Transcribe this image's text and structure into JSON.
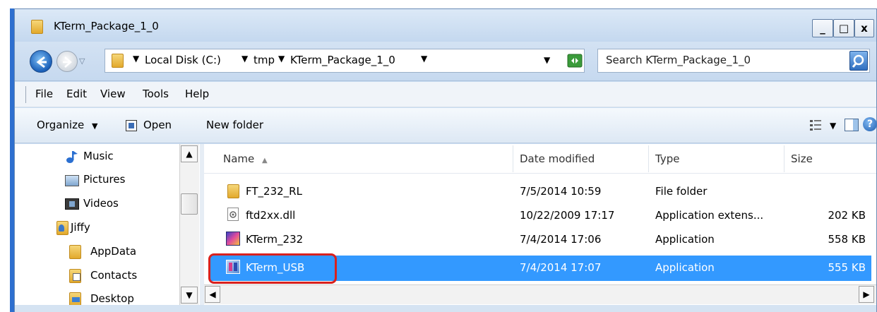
{
  "window": {
    "title": "KTerm_Package_1_0",
    "buttons": {
      "minimize": "_",
      "maximize": "□",
      "close": "x"
    }
  },
  "nav": {
    "breadcrumb": [
      "Local Disk (C:)",
      "tmp",
      "KTerm_Package_1_0"
    ],
    "search_placeholder": "Search KTerm_Package_1_0"
  },
  "menu": [
    "File",
    "Edit",
    "View",
    "Tools",
    "Help"
  ],
  "toolbar": {
    "organize": "Organize",
    "open": "Open",
    "new_folder": "New folder"
  },
  "sidebar": {
    "items": [
      {
        "label": "Music",
        "icon": "music-icon"
      },
      {
        "label": "Pictures",
        "icon": "pictures-icon"
      },
      {
        "label": "Videos",
        "icon": "videos-icon"
      },
      {
        "label": "Jiffy",
        "icon": "user-folder-icon"
      },
      {
        "label": "AppData",
        "icon": "folder-icon"
      },
      {
        "label": "Contacts",
        "icon": "contacts-icon"
      },
      {
        "label": "Desktop",
        "icon": "desktop-icon"
      }
    ]
  },
  "columns": {
    "name": "Name",
    "date": "Date modified",
    "type": "Type",
    "size": "Size"
  },
  "files": [
    {
      "name": "FT_232_RL",
      "date": "7/5/2014 10:59",
      "type": "File folder",
      "size": "",
      "icon": "folder-icon"
    },
    {
      "name": "ftd2xx.dll",
      "date": "10/22/2009 17:17",
      "type": "Application extens...",
      "size": "202 KB",
      "icon": "dll-icon"
    },
    {
      "name": "KTerm_232",
      "date": "7/4/2014 17:06",
      "type": "Application",
      "size": "558 KB",
      "icon": "kterm-app-icon"
    },
    {
      "name": "KTerm_USB",
      "date": "7/4/2014 17:07",
      "type": "Application",
      "size": "555 KB",
      "icon": "kterm-usb-icon",
      "selected": true
    }
  ],
  "colors": {
    "selection": "#3399ff",
    "highlight_box": "#d9211e",
    "frame_accent": "#2e6fcf"
  }
}
